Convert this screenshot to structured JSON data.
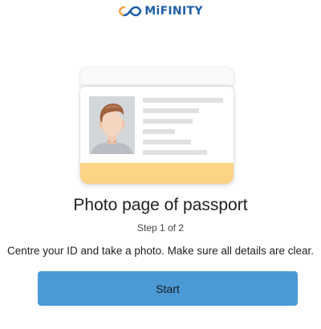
{
  "brand": {
    "name": "MiFINITY",
    "logo_icon": "infinity-icon",
    "color": "#1f5fa8",
    "accent": "#f3a64a"
  },
  "illustration": {
    "icon": "passport-id-card-icon",
    "stripe_color": "#fbd486"
  },
  "content": {
    "title": "Photo page of passport",
    "step": "Step 1 of 2",
    "instruction": "Centre your ID and take a photo. Make sure all details are clear."
  },
  "actions": {
    "start_label": "Start",
    "start_color": "#4b9ad6"
  }
}
